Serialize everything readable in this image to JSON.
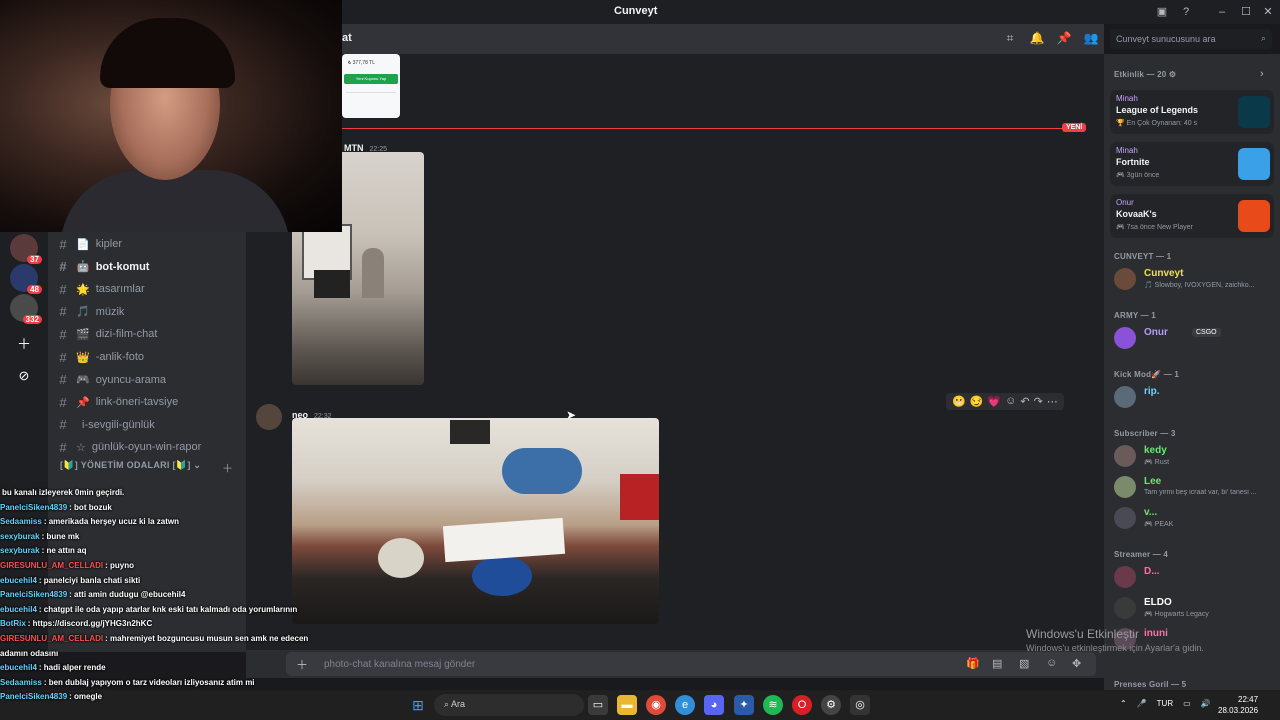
{
  "window": {
    "title": "Cunveyt"
  },
  "header": {
    "channel_title": "at",
    "search_placeholder": "Cunveyt sunucusunu ara"
  },
  "server_badges": [
    "37",
    "48",
    "332"
  ],
  "channels": [
    {
      "name": "kipler",
      "emoji": "📄",
      "active": false
    },
    {
      "name": "bot-komut",
      "emoji": "🤖",
      "active": true
    },
    {
      "name": "tasarımlar",
      "emoji": "🌟",
      "active": false
    },
    {
      "name": "müzik",
      "emoji": "🎵",
      "active": false
    },
    {
      "name": "dizi-film-chat",
      "emoji": "🎬",
      "active": false
    },
    {
      "name": "-anlik-foto",
      "emoji": "👑",
      "active": false
    },
    {
      "name": "oyuncu-arama",
      "emoji": "🎮",
      "active": false
    },
    {
      "name": "link-öneri-tavsiye",
      "emoji": "📌",
      "active": false
    },
    {
      "name": "i-sevgili-günlük",
      "emoji": "",
      "active": false
    },
    {
      "name": "günlük-oyun-win-rapor",
      "emoji": "☆",
      "active": false
    }
  ],
  "category_yonetim": "[🔰] YÖNETİM ODALARI [🔰] ⌄",
  "messages": [
    {
      "author": "MTN",
      "time": "22:25"
    },
    {
      "author": "neo",
      "time": "22:32"
    }
  ],
  "new_badge": "YENİ",
  "receipt": {
    "amount": "₺ 377,78 TL",
    "button": "Yeni Kuponu Yap"
  },
  "reactions": [
    "😬",
    "😏",
    "💗"
  ],
  "input_placeholder": "photo-chat kanalına mesaj gönder",
  "members": {
    "activity_header": "Etkinlik — 20 ⚙",
    "activities": [
      {
        "user": "Minah",
        "game": "League of Legends",
        "sub": "🏆 En Çok Oynanan: 40 s",
        "icon_color": "#0a3a4a"
      },
      {
        "user": "Minah",
        "game": "Fortnite",
        "sub": "🎮 3gün önce",
        "icon_color": "#3aa0e8"
      },
      {
        "user": "Onur",
        "game": "KovaaK's",
        "sub": "🎮 7sa önce    New Player",
        "icon_color": "#e84a1a"
      }
    ],
    "groups": [
      {
        "header": "CUNVEYT — 1",
        "members": [
          {
            "name": "Cunveyt",
            "sub": "🎵 Slowboy, IVOXYGEN, zaichko...",
            "color": "#f0e050",
            "avatar": "#6a4a3a"
          }
        ]
      },
      {
        "header": "ARMY — 1",
        "members": [
          {
            "name": "Onur",
            "sub": "",
            "tag": "CSGO",
            "color": "#b79cf5",
            "avatar": "#8a52d8"
          }
        ]
      },
      {
        "header": "Kick Mod🚀 — 1",
        "members": [
          {
            "name": "rip.",
            "sub": "",
            "color": "#74d4ff",
            "avatar": "#5a6a78"
          }
        ]
      },
      {
        "header": "Subscriber — 3",
        "members": [
          {
            "name": "kedy",
            "sub": "🎮 Rust",
            "color": "#6ce86c",
            "avatar": "#6a5a5a"
          },
          {
            "name": "Lee",
            "sub": "Tam yirmi beş icraat var, bi' tanesi ...",
            "color": "#6ce86c",
            "avatar": "#7a8a6a"
          },
          {
            "name": "v...",
            "sub": "🎮 PEAK",
            "color": "#6ce86c",
            "avatar": "#4a4a55"
          }
        ]
      },
      {
        "header": "Streamer — 4",
        "members": [
          {
            "name": "D...",
            "sub": "",
            "color": "#ff70a6",
            "avatar": "#6a3a4a"
          },
          {
            "name": "ELDO",
            "sub": "🎮 Hogwarts Legacy",
            "color": "#ffffff",
            "avatar": "#3a3a3a"
          },
          {
            "name": "inuni",
            "sub": "",
            "color": "#ff70a6",
            "avatar": "#5a4a5a"
          }
        ]
      }
    ],
    "last_header": "Prenses Goril — 5"
  },
  "windows_watermark": {
    "line1": "Windows'u Etkinleştir",
    "line2": "Windows'u etkinleştirmek için Ayarlar'a gidin."
  },
  "chat_overlay": [
    {
      "user": "",
      "text": "bu kanalı izleyerek 0min geçirdi.",
      "color": "#ffffff"
    },
    {
      "user": "PanelciSiken4839",
      "text": ": bot bozuk",
      "color": "#5fd4ff"
    },
    {
      "user": "Sedaamiss",
      "text": ": amerikada herşey ucuz ki la zatwn",
      "color": "#5fd4ff"
    },
    {
      "user": "sexyburak",
      "text": ": bune mk",
      "color": "#5fd4ff"
    },
    {
      "user": "sexyburak",
      "text": ": ne attın aq",
      "color": "#5fd4ff"
    },
    {
      "user": "GIRESUNLU_AM_CELLADI",
      "text": ": puyno",
      "color": "#ff4d4d"
    },
    {
      "user": "ebucehil4",
      "text": ": panelciyi banla chati sikti",
      "color": "#5fd4ff"
    },
    {
      "user": "PanelciSiken4839",
      "text": ": atti amin dudugu @ebucehil4",
      "color": "#5fd4ff"
    },
    {
      "user": "ebucehil4",
      "text": ": chatgpt ile oda yapıp atarlar knk eski tatı kalmadı oda yorumlarının",
      "color": "#5fd4ff"
    },
    {
      "user": "BotRix",
      "text": ": https://discord.gg/jYHG3n2hKC",
      "color": "#5fd4ff"
    },
    {
      "user": "GIRESUNLU_AM_CELLADI",
      "text": ": mahremiyet bozguncusu musun sen amk ne edecen adamın odasını",
      "color": "#ff4d4d"
    },
    {
      "user": "ebucehil4",
      "text": ": hadi alper rende",
      "color": "#5fd4ff"
    },
    {
      "user": "Sedaamiss",
      "text": ": ben dublaj yapıyom o tarz videoları izliyosanız atim mi",
      "color": "#5fd4ff"
    },
    {
      "user": "PanelciSiken4839",
      "text": ": omegle",
      "color": "#5fd4ff"
    }
  ],
  "taskbar": {
    "search_label": "Ara",
    "lang": "TUR",
    "time": "22:47",
    "date": "28.03.2026"
  },
  "icons": [
    "pin-icon",
    "bell-icon",
    "members-icon",
    "search-icon",
    "windows-start-icon",
    "discord-icon",
    "chrome-icon"
  ]
}
